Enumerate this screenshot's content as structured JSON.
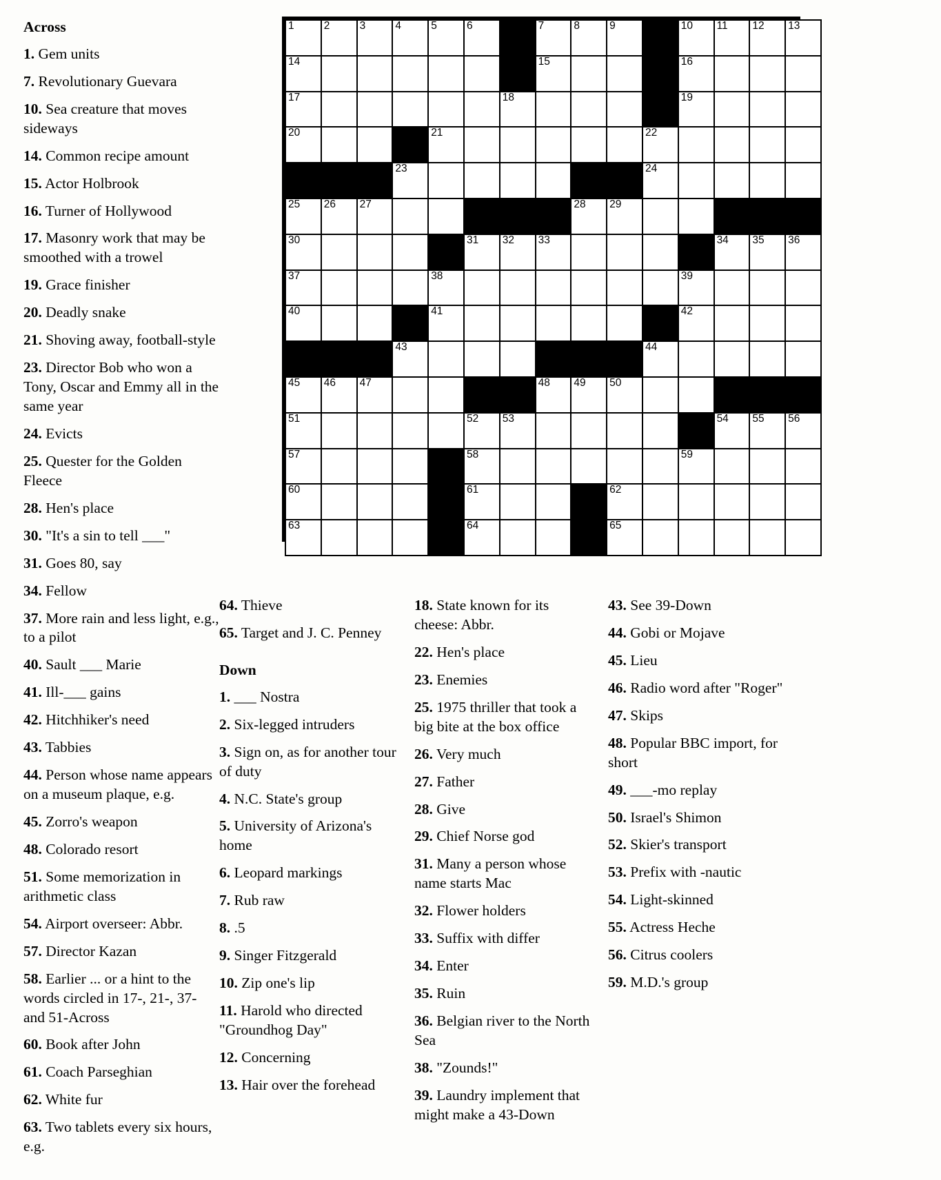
{
  "puzzle": {
    "across_heading": "Across",
    "down_heading": "Down",
    "across": [
      {
        "num": "1.",
        "text": "Gem units"
      },
      {
        "num": "7.",
        "text": "Revolutionary Guevara"
      },
      {
        "num": "10.",
        "text": "Sea creature that moves sideways"
      },
      {
        "num": "14.",
        "text": "Common recipe amount"
      },
      {
        "num": "15.",
        "text": "Actor Holbrook"
      },
      {
        "num": "16.",
        "text": "Turner of Hollywood"
      },
      {
        "num": "17.",
        "text": "Masonry work that may be smoothed with a trowel"
      },
      {
        "num": "19.",
        "text": "Grace finisher"
      },
      {
        "num": "20.",
        "text": "Deadly snake"
      },
      {
        "num": "21.",
        "text": "Shoving away, football-style"
      },
      {
        "num": "23.",
        "text": "Director Bob who won a Tony, Oscar and Emmy all in the same year"
      },
      {
        "num": "24.",
        "text": "Evicts"
      },
      {
        "num": "25.",
        "text": "Quester for the Golden Fleece"
      },
      {
        "num": "28.",
        "text": "Hen's place"
      },
      {
        "num": "30.",
        "text": "\"It's a sin to tell ___\""
      },
      {
        "num": "31.",
        "text": "Goes 80, say"
      },
      {
        "num": "34.",
        "text": "Fellow"
      },
      {
        "num": "37.",
        "text": "More rain and less light, e.g., to a pilot"
      },
      {
        "num": "40.",
        "text": "Sault ___ Marie"
      },
      {
        "num": "41.",
        "text": "Ill-___ gains"
      },
      {
        "num": "42.",
        "text": "Hitchhiker's need"
      },
      {
        "num": "43.",
        "text": "Tabbies"
      },
      {
        "num": "44.",
        "text": "Person whose name appears on a museum plaque, e.g."
      },
      {
        "num": "45.",
        "text": "Zorro's weapon"
      },
      {
        "num": "48.",
        "text": "Colorado resort"
      },
      {
        "num": "51.",
        "text": "Some memorization in arithmetic class"
      },
      {
        "num": "54.",
        "text": "Airport overseer: Abbr."
      },
      {
        "num": "57.",
        "text": "Director Kazan"
      },
      {
        "num": "58.",
        "text": "Earlier ... or a hint to the words circled in 17-, 21-, 37- and 51-Across"
      },
      {
        "num": "60.",
        "text": "Book after John"
      },
      {
        "num": "61.",
        "text": "Coach Parseghian"
      },
      {
        "num": "62.",
        "text": "White fur"
      },
      {
        "num": "63.",
        "text": "Two tablets every six hours, e.g."
      },
      {
        "num": "64.",
        "text": "Thieve"
      },
      {
        "num": "65.",
        "text": "Target and J. C. Penney"
      }
    ],
    "down": [
      {
        "num": "1.",
        "text": "___ Nostra"
      },
      {
        "num": "2.",
        "text": "Six-legged intruders"
      },
      {
        "num": "3.",
        "text": "Sign on, as for another tour of duty"
      },
      {
        "num": "4.",
        "text": "N.C. State's group"
      },
      {
        "num": "5.",
        "text": "University of Arizona's home"
      },
      {
        "num": "6.",
        "text": "Leopard markings"
      },
      {
        "num": "7.",
        "text": "Rub raw"
      },
      {
        "num": "8.",
        "text": ".5"
      },
      {
        "num": "9.",
        "text": "Singer Fitzgerald"
      },
      {
        "num": "10.",
        "text": "Zip one's lip"
      },
      {
        "num": "11.",
        "text": "Harold who directed \"Groundhog Day\""
      },
      {
        "num": "12.",
        "text": "Concerning"
      },
      {
        "num": "13.",
        "text": "Hair over the forehead"
      },
      {
        "num": "18.",
        "text": "State known for its cheese: Abbr."
      },
      {
        "num": "22.",
        "text": "Hen's place"
      },
      {
        "num": "23.",
        "text": "Enemies"
      },
      {
        "num": "25.",
        "text": "1975 thriller that took a big bite at the box office"
      },
      {
        "num": "26.",
        "text": "Very much"
      },
      {
        "num": "27.",
        "text": "Father"
      },
      {
        "num": "28.",
        "text": "Give"
      },
      {
        "num": "29.",
        "text": "Chief Norse god"
      },
      {
        "num": "31.",
        "text": "Many a person whose name starts Mac"
      },
      {
        "num": "32.",
        "text": "Flower holders"
      },
      {
        "num": "33.",
        "text": "Suffix with differ"
      },
      {
        "num": "34.",
        "text": "Enter"
      },
      {
        "num": "35.",
        "text": "Ruin"
      },
      {
        "num": "36.",
        "text": "Belgian river to the North Sea"
      },
      {
        "num": "38.",
        "text": "\"Zounds!\""
      },
      {
        "num": "39.",
        "text": "Laundry implement that might make a 43-Down"
      },
      {
        "num": "43.",
        "text": "See 39-Down"
      },
      {
        "num": "44.",
        "text": "Gobi or Mojave"
      },
      {
        "num": "45.",
        "text": "Lieu"
      },
      {
        "num": "46.",
        "text": "Radio word after \"Roger\""
      },
      {
        "num": "47.",
        "text": "Skips"
      },
      {
        "num": "48.",
        "text": "Popular BBC import, for short"
      },
      {
        "num": "49.",
        "text": "___-mo replay"
      },
      {
        "num": "50.",
        "text": "Israel's Shimon"
      },
      {
        "num": "52.",
        "text": "Skier's transport"
      },
      {
        "num": "53.",
        "text": "Prefix with -nautic"
      },
      {
        "num": "54.",
        "text": "Light-skinned"
      },
      {
        "num": "55.",
        "text": "Actress Heche"
      },
      {
        "num": "56.",
        "text": "Citrus coolers"
      },
      {
        "num": "59.",
        "text": "M.D.'s group"
      }
    ],
    "grid": {
      "cols": 15,
      "rows": 15,
      "block_color": "#000000",
      "cell_color": "#ffffff",
      "rows_data": [
        [
          {
            "n": "1"
          },
          {
            "n": "2"
          },
          {
            "n": "3"
          },
          {
            "n": "4"
          },
          {
            "n": "5"
          },
          {
            "n": "6"
          },
          {
            "b": 1
          },
          {
            "n": "7"
          },
          {
            "n": "8"
          },
          {
            "n": "9"
          },
          {
            "b": 1
          },
          {
            "n": "10"
          },
          {
            "n": "11"
          },
          {
            "n": "12"
          },
          {
            "n": "13"
          }
        ],
        [
          {
            "n": "14"
          },
          {},
          {},
          {},
          {},
          {},
          {
            "b": 1
          },
          {
            "n": "15"
          },
          {},
          {},
          {
            "b": 1
          },
          {
            "n": "16"
          },
          {},
          {},
          {}
        ],
        [
          {
            "n": "17"
          },
          {},
          {},
          {},
          {},
          {},
          {
            "n": "18"
          },
          {},
          {},
          {},
          {
            "b": 1
          },
          {
            "n": "19"
          },
          {},
          {},
          {}
        ],
        [
          {
            "n": "20"
          },
          {},
          {},
          {
            "b": 1
          },
          {
            "n": "21"
          },
          {},
          {},
          {},
          {},
          {},
          {
            "n": "22"
          },
          {},
          {},
          {},
          {}
        ],
        [
          {
            "b": 1
          },
          {
            "b": 1
          },
          {
            "b": 1
          },
          {
            "n": "23"
          },
          {},
          {},
          {},
          {},
          {
            "b": 1
          },
          {
            "b": 1
          },
          {
            "n": "24"
          },
          {},
          {},
          {},
          {}
        ],
        [
          {
            "n": "25"
          },
          {
            "n": "26"
          },
          {
            "n": "27"
          },
          {},
          {},
          {
            "b": 1
          },
          {
            "b": 1
          },
          {
            "b": 1
          },
          {
            "n": "28"
          },
          {
            "n": "29"
          },
          {},
          {},
          {
            "b": 1
          },
          {
            "b": 1
          },
          {
            "b": 1
          }
        ],
        [
          {
            "n": "30"
          },
          {},
          {},
          {},
          {
            "b": 1
          },
          {
            "n": "31"
          },
          {
            "n": "32"
          },
          {
            "n": "33"
          },
          {},
          {},
          {},
          {
            "b": 1
          },
          {
            "n": "34"
          },
          {
            "n": "35"
          },
          {
            "n": "36"
          }
        ],
        [
          {
            "n": "37"
          },
          {},
          {},
          {},
          {
            "n": "38"
          },
          {},
          {},
          {},
          {},
          {},
          {},
          {
            "n": "39"
          },
          {},
          {},
          {}
        ],
        [
          {
            "n": "40"
          },
          {},
          {},
          {
            "b": 1
          },
          {
            "n": "41"
          },
          {},
          {},
          {},
          {},
          {},
          {
            "b": 1
          },
          {
            "n": "42"
          },
          {},
          {},
          {}
        ],
        [
          {
            "b": 1
          },
          {
            "b": 1
          },
          {
            "b": 1
          },
          {
            "n": "43"
          },
          {},
          {},
          {},
          {
            "b": 1
          },
          {
            "b": 1
          },
          {
            "b": 1
          },
          {
            "n": "44"
          },
          {},
          {},
          {},
          {}
        ],
        [
          {
            "n": "45"
          },
          {
            "n": "46"
          },
          {
            "n": "47"
          },
          {},
          {},
          {
            "b": 1
          },
          {
            "b": 1
          },
          {
            "n": "48"
          },
          {
            "n": "49"
          },
          {
            "n": "50"
          },
          {},
          {},
          {
            "b": 1
          },
          {
            "b": 1
          },
          {
            "b": 1
          }
        ],
        [
          {
            "n": "51"
          },
          {},
          {},
          {},
          {},
          {
            "n": "52"
          },
          {
            "n": "53"
          },
          {},
          {},
          {},
          {},
          {
            "b": 1
          },
          {
            "n": "54"
          },
          {
            "n": "55"
          },
          {
            "n": "56"
          }
        ],
        [
          {
            "n": "57"
          },
          {},
          {},
          {},
          {
            "b": 1
          },
          {
            "n": "58"
          },
          {},
          {},
          {},
          {},
          {},
          {
            "n": "59"
          },
          {},
          {},
          {}
        ],
        [
          {
            "n": "60"
          },
          {},
          {},
          {},
          {
            "b": 1
          },
          {
            "n": "61"
          },
          {},
          {},
          {
            "b": 1
          },
          {
            "n": "62"
          },
          {},
          {},
          {},
          {},
          {}
        ],
        [
          {
            "n": "63"
          },
          {},
          {},
          {},
          {
            "b": 1
          },
          {
            "n": "64"
          },
          {},
          {},
          {
            "b": 1
          },
          {
            "n": "65"
          },
          {},
          {},
          {},
          {},
          {}
        ]
      ]
    }
  }
}
